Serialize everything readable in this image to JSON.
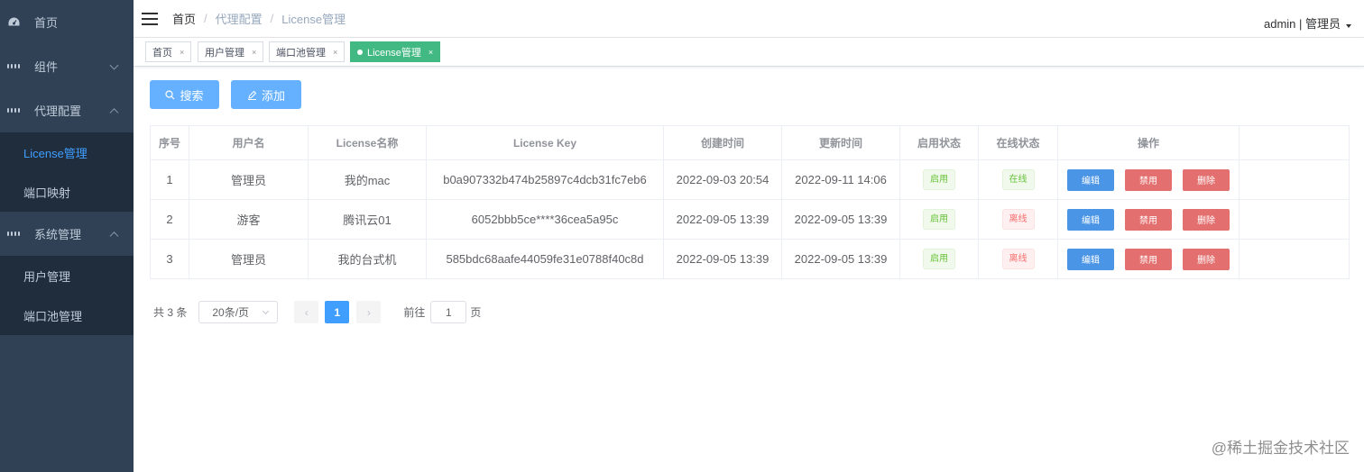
{
  "sidebar": {
    "items": [
      {
        "label": "首页"
      },
      {
        "label": "组件"
      },
      {
        "label": "代理配置"
      },
      {
        "label": "License管理"
      },
      {
        "label": "端口映射"
      },
      {
        "label": "系统管理"
      },
      {
        "label": "用户管理"
      },
      {
        "label": "端口池管理"
      }
    ]
  },
  "header": {
    "breadcrumb": [
      "首页",
      "/",
      "代理配置",
      "/",
      "License管理"
    ],
    "user": "admin | 管理员"
  },
  "tags": [
    {
      "label": "首页",
      "close": "×"
    },
    {
      "label": "用户管理",
      "close": "×"
    },
    {
      "label": "端口池管理",
      "close": "×"
    },
    {
      "label": "License管理",
      "close": "×"
    }
  ],
  "toolbar": {
    "search_label": "搜索",
    "add_label": "添加"
  },
  "table": {
    "columns": [
      "序号",
      "用户名",
      "License名称",
      "License Key",
      "创建时间",
      "更新时间",
      "启用状态",
      "在线状态",
      "操作"
    ],
    "rows": [
      {
        "idx": "1",
        "user": "管理员",
        "name": "我的mac",
        "key": "b0a907332b474b25897c4dcb31fc7eb6",
        "created": "2022-09-03 20:54",
        "updated": "2022-09-11 14:06",
        "enabled": "启用",
        "online": "在线"
      },
      {
        "idx": "2",
        "user": "游客",
        "name": "腾讯云01",
        "key": "6052bbb5ce****36cea5a95c",
        "created": "2022-09-05 13:39",
        "updated": "2022-09-05 13:39",
        "enabled": "启用",
        "online": "离线"
      },
      {
        "idx": "3",
        "user": "管理员",
        "name": "我的台式机",
        "key": "585bdc68aafe44059fe31e0788f40c8d",
        "created": "2022-09-05 13:39",
        "updated": "2022-09-05 13:39",
        "enabled": "启用",
        "online": "离线"
      }
    ],
    "actions": {
      "edit": "编辑",
      "disable": "禁用",
      "delete": "删除"
    }
  },
  "pagination": {
    "total": "共 3 条",
    "page_size": "20条/页",
    "current": "1",
    "goto_prefix": "前往",
    "goto_value": "1",
    "goto_suffix": "页",
    "prev": "‹",
    "next": "›"
  },
  "watermark": "@稀土掘金技术社区",
  "colors": {
    "sidebar_bg": "#304156",
    "submenu_bg": "#1f2d3d",
    "active_link": "#409eff",
    "active_tag": "#42b983",
    "primary_button": "#66b1ff",
    "danger_button": "#e46f6f"
  }
}
